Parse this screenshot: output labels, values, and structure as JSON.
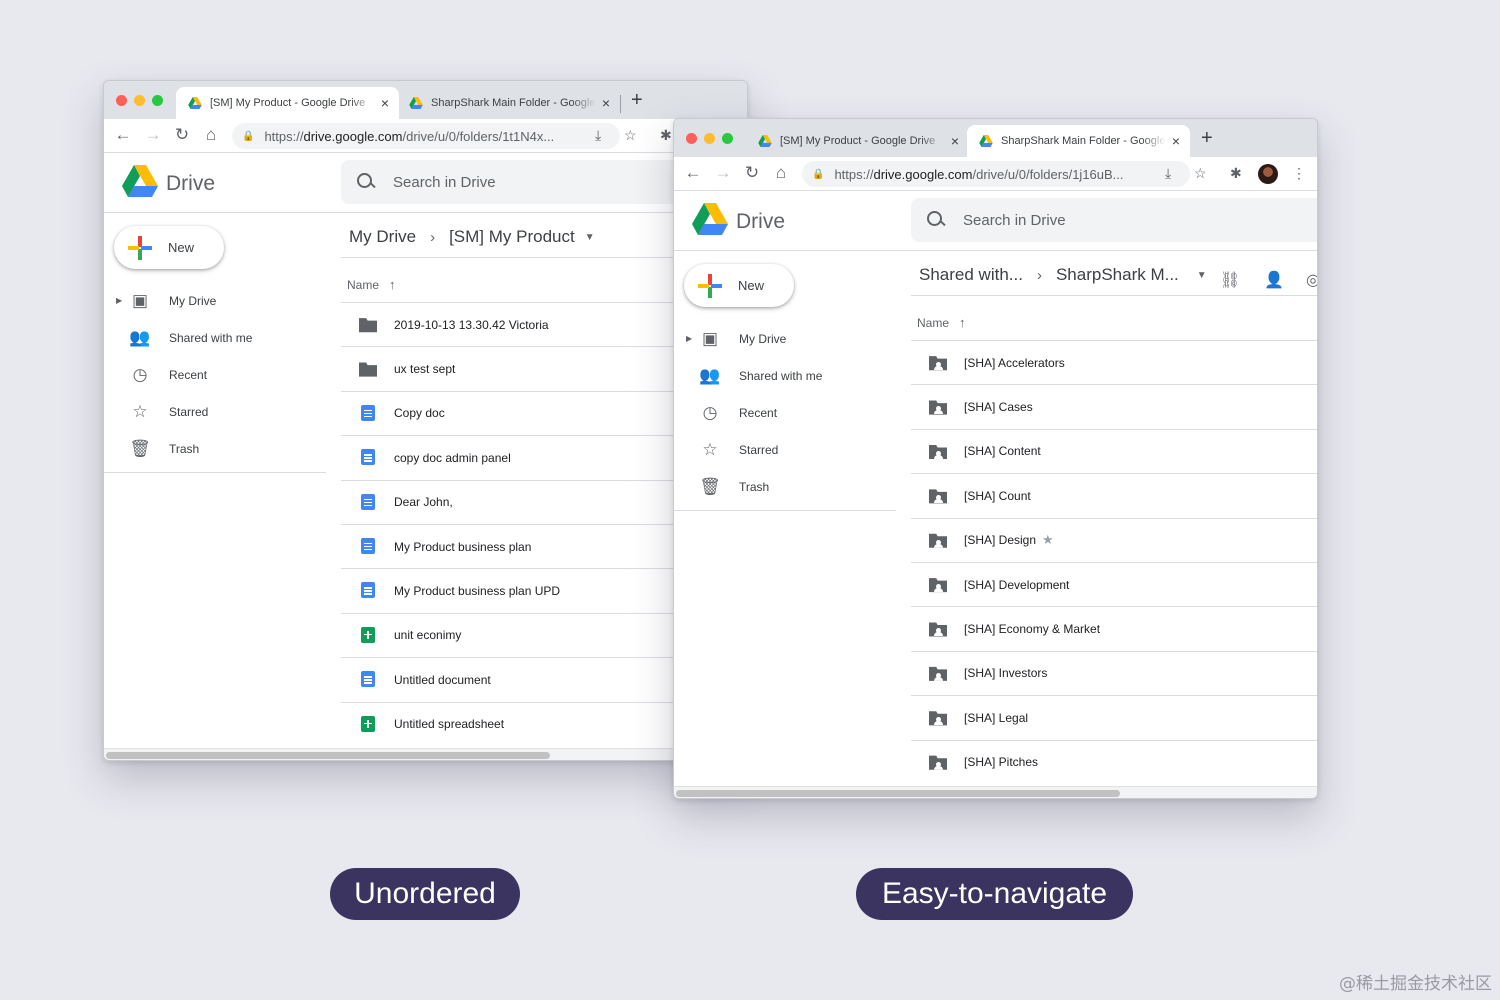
{
  "windows": [
    {
      "tabs": [
        {
          "title": "[SM] My Product - Google Drive",
          "close": "×"
        },
        {
          "title": "SharpShark Main Folder - Google Drive",
          "close": "×"
        }
      ],
      "new_tab": "+",
      "address": {
        "scheme": "https://",
        "host": "drive.google.com",
        "path": "/drive/u/0/folders/1t1N4x..."
      },
      "app_name": "Drive",
      "search_placeholder": "Search in Drive",
      "new_button": "New",
      "sidebar": [
        {
          "label": "My Drive",
          "icon": "my-drive-icon"
        },
        {
          "label": "Shared with me",
          "icon": "shared-icon"
        },
        {
          "label": "Recent",
          "icon": "clock-icon"
        },
        {
          "label": "Starred",
          "icon": "star-icon"
        },
        {
          "label": "Trash",
          "icon": "trash-icon"
        }
      ],
      "breadcrumb": {
        "parent": "My Drive",
        "current": "[SM] My Product"
      },
      "column_name": "Name",
      "files": [
        {
          "name": "2019-10-13 13.30.42 Victoria",
          "type": "folder"
        },
        {
          "name": "ux test sept",
          "type": "folder"
        },
        {
          "name": "Copy doc",
          "type": "doc"
        },
        {
          "name": "copy doc admin panel",
          "type": "doc"
        },
        {
          "name": "Dear John,",
          "type": "doc"
        },
        {
          "name": "My Product business plan",
          "type": "doc"
        },
        {
          "name": "My Product business plan UPD",
          "type": "doc"
        },
        {
          "name": "unit econimy",
          "type": "sheet"
        },
        {
          "name": "Untitled document",
          "type": "doc"
        },
        {
          "name": "Untitled spreadsheet",
          "type": "sheet"
        }
      ],
      "scroll_fraction": 0.69
    },
    {
      "tabs": [
        {
          "title": "[SM] My Product - Google Drive",
          "close": "×"
        },
        {
          "title": "SharpShark Main Folder - Google Drive",
          "close": "×"
        }
      ],
      "new_tab": "+",
      "address": {
        "scheme": "https://",
        "host": "drive.google.com",
        "path": "/drive/u/0/folders/1j16uB..."
      },
      "app_name": "Drive",
      "search_placeholder": "Search in Drive",
      "new_button": "New",
      "sidebar": [
        {
          "label": "My Drive",
          "icon": "my-drive-icon"
        },
        {
          "label": "Shared with me",
          "icon": "shared-icon"
        },
        {
          "label": "Recent",
          "icon": "clock-icon"
        },
        {
          "label": "Starred",
          "icon": "star-icon"
        },
        {
          "label": "Trash",
          "icon": "trash-icon"
        }
      ],
      "breadcrumb": {
        "parent": "Shared with...",
        "current": "SharpShark M..."
      },
      "column_name": "Name",
      "files": [
        {
          "name": "[SHA] Accelerators",
          "type": "shared-folder"
        },
        {
          "name": "[SHA] Cases",
          "type": "shared-folder"
        },
        {
          "name": "[SHA] Content",
          "type": "shared-folder"
        },
        {
          "name": "[SHA] Count",
          "type": "shared-folder"
        },
        {
          "name": "[SHA] Design",
          "type": "shared-folder",
          "starred": true
        },
        {
          "name": "[SHA] Development",
          "type": "shared-folder"
        },
        {
          "name": "[SHA] Economy & Market",
          "type": "shared-folder"
        },
        {
          "name": "[SHA] Investors",
          "type": "shared-folder"
        },
        {
          "name": "[SHA] Legal",
          "type": "shared-folder"
        },
        {
          "name": "[SHA] Pitches",
          "type": "shared-folder"
        }
      ],
      "scroll_fraction": 0.69
    }
  ],
  "labels": {
    "left": "Unordered",
    "right": "Easy-to-navigate"
  },
  "watermark": "@稀土掘金技术社区",
  "colors": {
    "pill": "#3b3360",
    "background": "#e8e8ef"
  }
}
